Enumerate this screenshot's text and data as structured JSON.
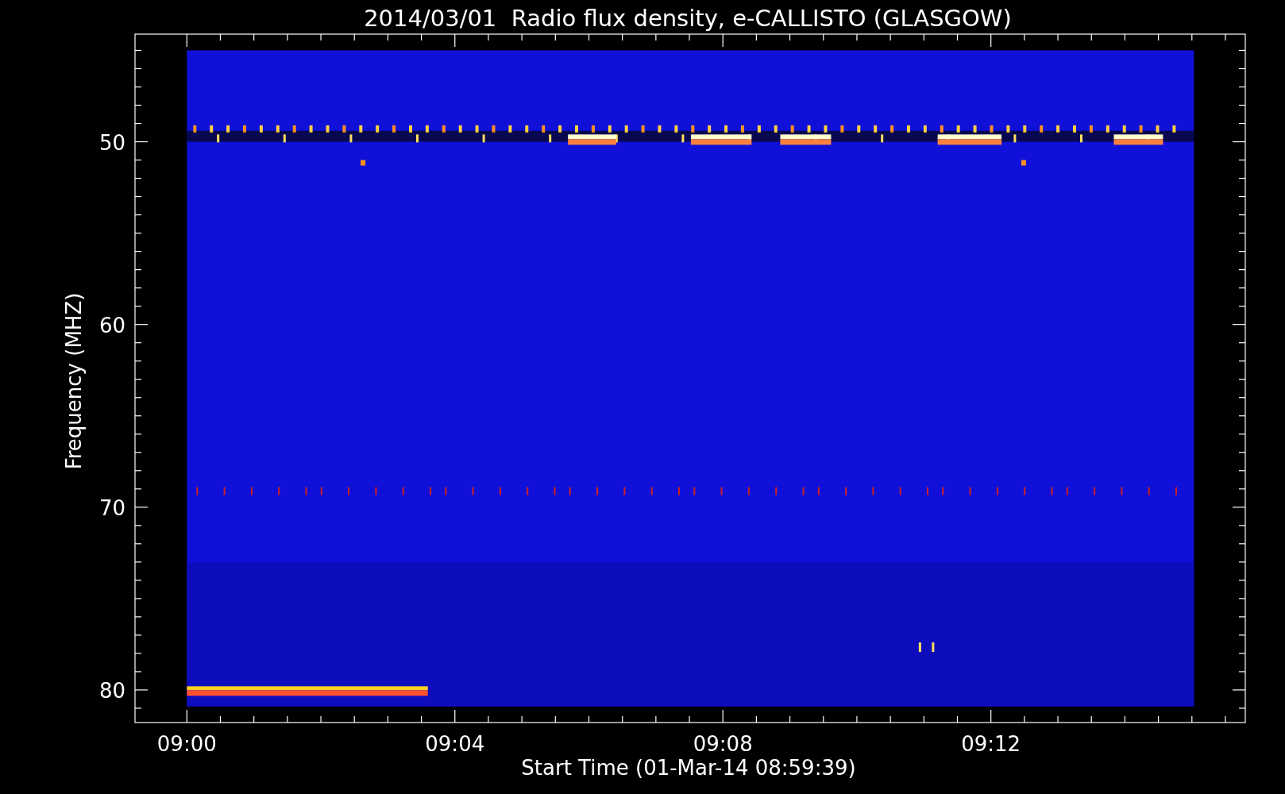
{
  "title": "2014/03/01  Radio flux density, e-CALLISTO (GLASGOW)",
  "y_axis": {
    "label": "Frequency (MHZ)",
    "ticks": [
      "50",
      "60",
      "70",
      "80"
    ]
  },
  "x_axis": {
    "label": "Start Time (01-Mar-14 08:59:39)",
    "ticks": [
      "09:00",
      "09:04",
      "09:08",
      "09:12"
    ]
  }
}
